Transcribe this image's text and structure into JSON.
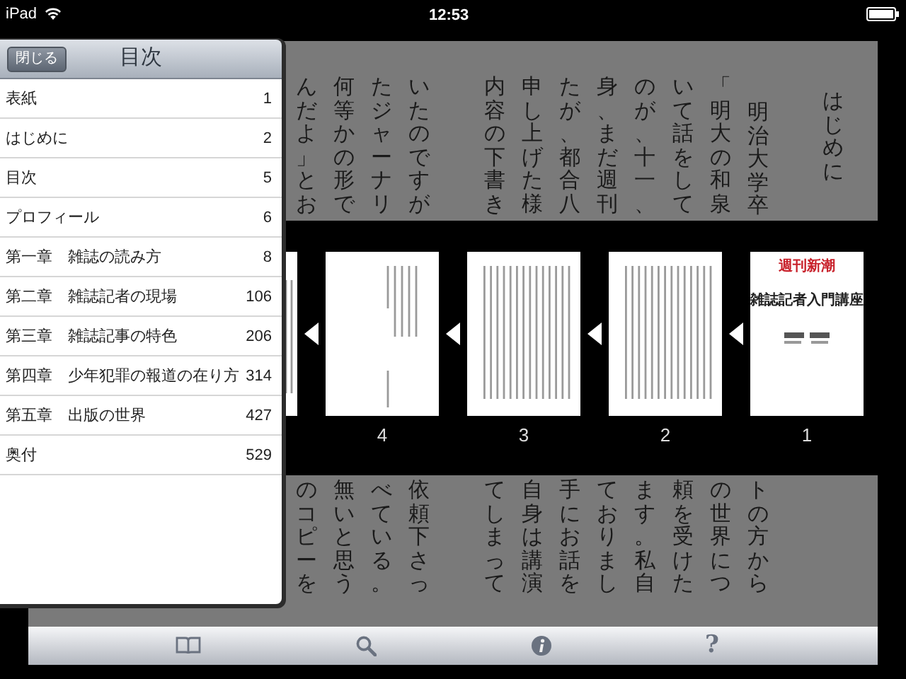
{
  "status_bar": {
    "device": "iPad",
    "time": "12:53"
  },
  "page": {
    "columns": [
      {
        "kind": "text",
        "top": "んだよ」とお",
        "bottom": "のコピーを"
      },
      {
        "kind": "text",
        "top": "何等かの形で",
        "bottom": "無いと思う"
      },
      {
        "kind": "text",
        "top": "たジャーナリ",
        "bottom": "べている。"
      },
      {
        "kind": "text",
        "top": "いたのですが",
        "bottom": "依頼下さっ"
      },
      {
        "kind": "blank"
      },
      {
        "kind": "text",
        "top": "内容の下書き",
        "bottom": "てしまって"
      },
      {
        "kind": "text",
        "top": "申し上げた様",
        "bottom": "自身は講演"
      },
      {
        "kind": "text",
        "top": "たが、都合八",
        "bottom": "手にお話を"
      },
      {
        "kind": "text",
        "top": "身、まだ週刊",
        "bottom": "ておりまし"
      },
      {
        "kind": "text",
        "top": "のが、十一、",
        "bottom": "ます。私自"
      },
      {
        "kind": "text",
        "top": "いて話をして",
        "bottom": "頼を受けた"
      },
      {
        "kind": "text",
        "top": "「明大の和泉",
        "bottom": "の世界につ"
      },
      {
        "kind": "indent",
        "top": "明治大学卒",
        "bottom": "トの方から"
      },
      {
        "kind": "blank"
      },
      {
        "kind": "heading",
        "top": "はじめに"
      }
    ]
  },
  "thumbnails": [
    {
      "kind": "partial"
    },
    {
      "kind": "sparse",
      "page": "4"
    },
    {
      "kind": "text",
      "page": "3"
    },
    {
      "kind": "text",
      "page": "2"
    },
    {
      "kind": "cover",
      "page": "1",
      "series": "週刊新潮",
      "title": "雑誌記者入門講座"
    }
  ],
  "toc": {
    "close_button": "閉じる",
    "title": "目次",
    "items": [
      {
        "label": "表紙",
        "page": "1"
      },
      {
        "label": "はじめに",
        "page": "2"
      },
      {
        "label": "目次",
        "page": "5"
      },
      {
        "label": "プロフィール",
        "page": "6"
      },
      {
        "label": "第一章　雑誌の読み方",
        "page": "8"
      },
      {
        "label": "第二章　雑誌記者の現場",
        "page": "106"
      },
      {
        "label": "第三章　雑誌記事の特色",
        "page": "206"
      },
      {
        "label": "第四章　少年犯罪の報道の在り方",
        "page": "314"
      },
      {
        "label": "第五章　出版の世界",
        "page": "427"
      },
      {
        "label": "奥付",
        "page": "529"
      }
    ]
  },
  "toolbar": [
    {
      "kind": "book"
    },
    {
      "kind": "search"
    },
    {
      "kind": "info"
    },
    {
      "kind": "glyph",
      "text": "?"
    }
  ]
}
